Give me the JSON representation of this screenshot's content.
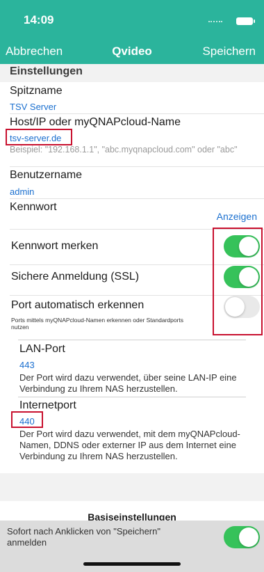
{
  "status": {
    "time": "14:09"
  },
  "nav": {
    "cancel": "Abbrechen",
    "title": "Qvideo",
    "save": "Speichern"
  },
  "section": {
    "settings_title": "Einstellungen"
  },
  "fields": {
    "nickname_label": "Spitzname",
    "nickname_value": "TSV Server",
    "host_label": "Host/IP oder myQNAPcloud-Name",
    "host_value": "tsv-server.de",
    "host_hint": "Beispiel: \"192.168.1.1\", \"abc.myqnapcloud.com\" oder \"abc\"",
    "username_label": "Benutzername",
    "username_value": "admin",
    "password_label": "Kennwort",
    "show_password": "Anzeigen"
  },
  "toggles": [
    {
      "label": "Kennwort merken",
      "on": true
    },
    {
      "label": "Sichere Anmeldung (SSL)",
      "on": true
    },
    {
      "label": "Port automatisch erkennen",
      "on": false,
      "note": "Ports mittels myQNAPcloud-Namen erkennen oder Standardports nutzen"
    }
  ],
  "ports": {
    "lan_label": "LAN-Port",
    "lan_value": "443",
    "lan_desc": "Der Port wird dazu verwendet, über seine LAN-IP eine Verbindung zu Ihrem NAS herzustellen.",
    "internet_label": "Internetport",
    "internet_value": "440",
    "internet_desc": "Der Port wird dazu verwendet, mit dem myQNAPcloud-Namen, DDNS oder externer IP aus dem Internet eine Verbindung zu Ihrem NAS herzustellen."
  },
  "basic": {
    "title": "Basiseinstellungen",
    "auto_login_label": "Sofort nach Anklicken von \"Speichern\" anmelden",
    "auto_login_on": true
  },
  "colors": {
    "accent": "#2bb49c",
    "toggle_on": "#36c25a",
    "link": "#1a6fcf",
    "highlight": "#c8102e"
  }
}
